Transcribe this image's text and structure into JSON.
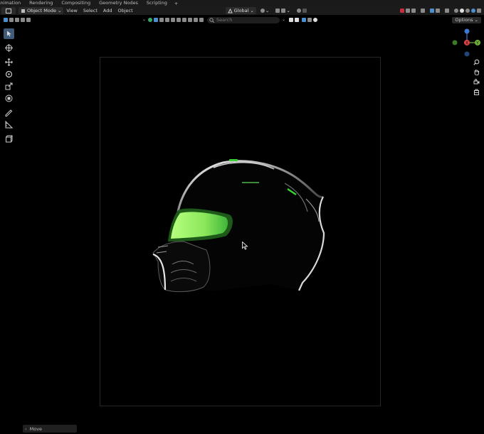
{
  "workspace_tabs": [
    "Animation",
    "Rendering",
    "Compositing",
    "Geometry Nodes",
    "Scripting"
  ],
  "workspace_add": "+",
  "header": {
    "mode": "Object Mode",
    "menus": [
      "View",
      "Select",
      "Add",
      "Object"
    ],
    "transform_orientation": "Global"
  },
  "search": {
    "placeholder": "Search"
  },
  "options_label": "Options",
  "gizmo": {
    "x_label": "X",
    "y_label": "Y",
    "x_color": "#e0404a",
    "y_color": "#6fb33a",
    "z_color": "#3c78d8"
  },
  "last_operation": {
    "label": "Move"
  },
  "colors": {
    "accent": "#3f5b78",
    "visor": "#8be65a",
    "highlight": "#39d03a"
  }
}
